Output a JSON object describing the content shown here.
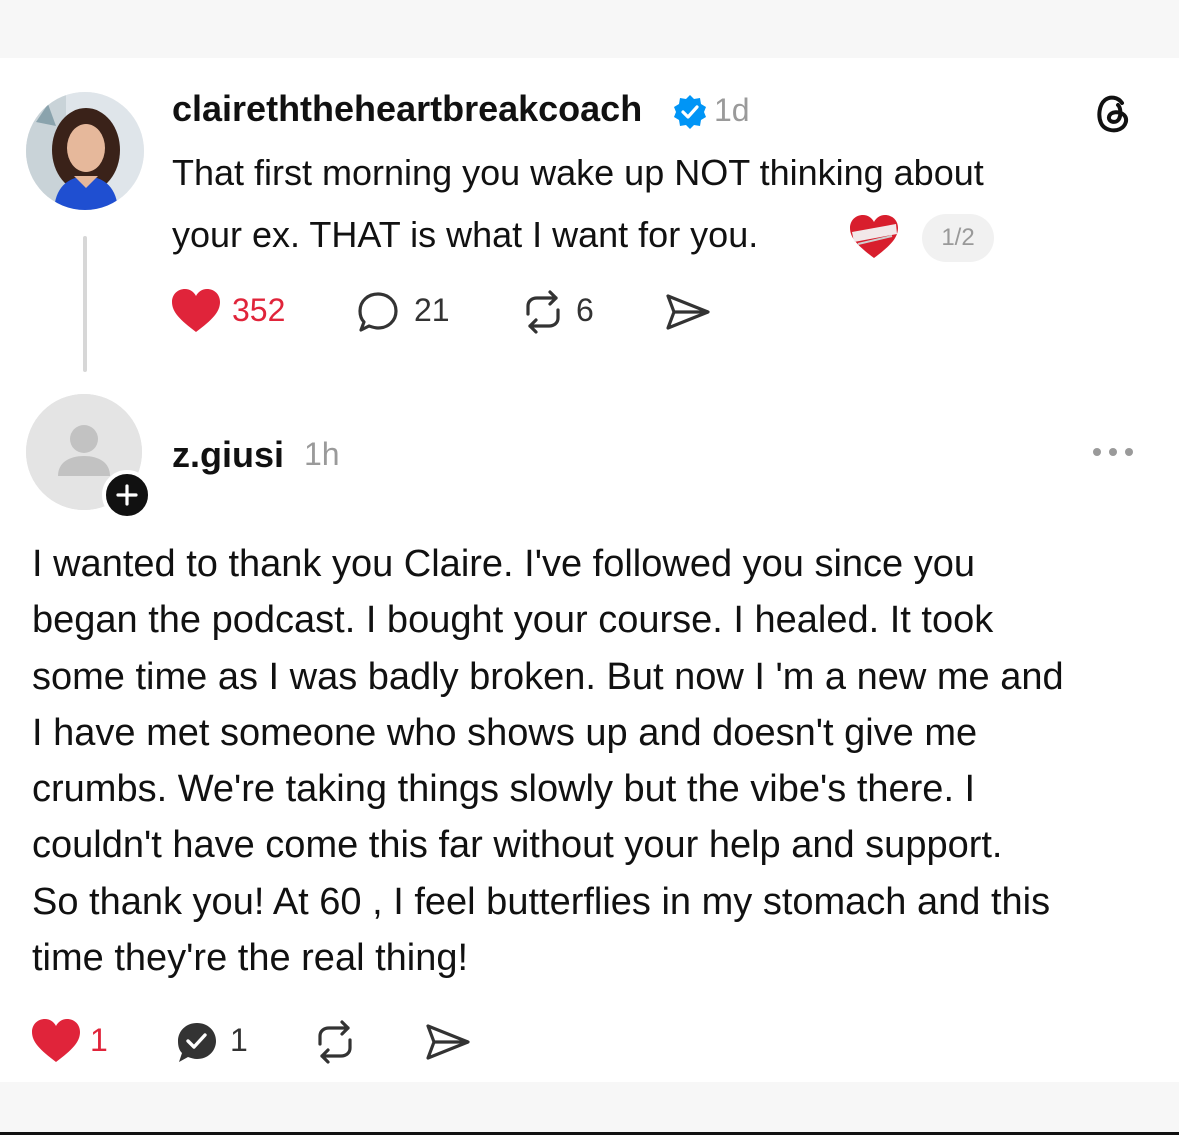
{
  "post": {
    "username": "claireththeheartbreakcoach",
    "time": "1d",
    "text_lines": [
      "That first morning you wake up NOT thinking about",
      "your ex. THAT is what I want for you."
    ],
    "thread_page": "1/2",
    "likes": "352",
    "replies": "21",
    "reposts": "6"
  },
  "reply": {
    "username": "z.giusi",
    "time": "1h",
    "text_lines": [
      "I wanted to thank you Claire. I've followed you since you",
      "began the podcast. I bought your course. I healed. It took",
      "some time as I was badly broken. But now I 'm a new me and",
      "I have met someone who shows up and doesn't give me",
      "crumbs. We're taking things slowly but the vibe's there. I",
      "couldn't have come this far without your help and support.",
      "So thank you! At 60 , I feel butterflies in my stomach and this",
      "time they're the real thing!"
    ],
    "likes": "1",
    "replies": "1"
  },
  "icons": {
    "avatar": "profile-photo",
    "verified": "verified-badge-icon",
    "app": "threads-logo-icon",
    "emoji": "mending-heart-emoji",
    "like": "heart-icon",
    "reply": "comment-bubble-icon",
    "repost": "repost-icon",
    "share": "send-icon",
    "more": "more-dots-icon",
    "follow": "plus-icon"
  },
  "colors": {
    "like_red": "#e0243a",
    "verified_blue": "#0095f6",
    "text": "#111111",
    "muted": "#9a9a9a"
  }
}
